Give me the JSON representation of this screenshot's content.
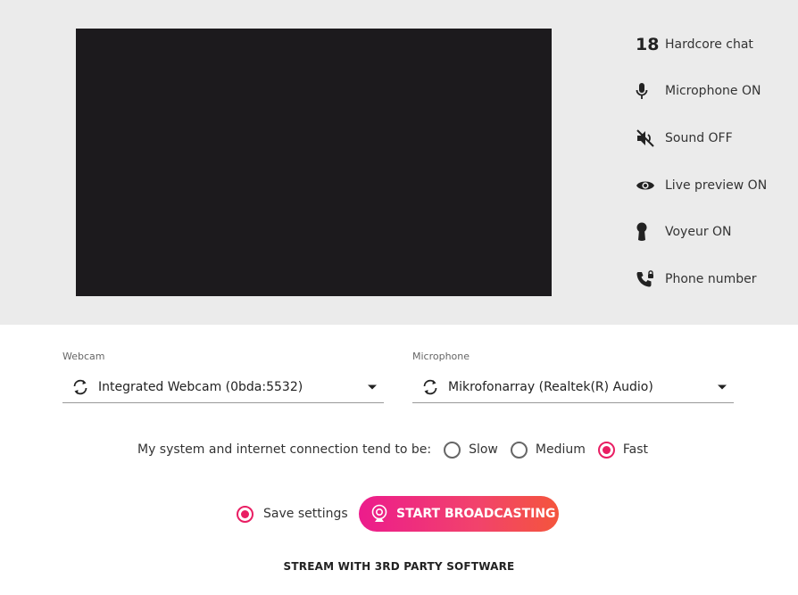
{
  "side_menu": {
    "items": [
      {
        "number": "18",
        "label": "Hardcore chat",
        "icon": "eighteen-badge"
      },
      {
        "label": "Microphone ON",
        "icon": "microphone-icon"
      },
      {
        "label": "Sound OFF",
        "icon": "sound-off-icon"
      },
      {
        "label": "Live preview ON",
        "icon": "eye-icon"
      },
      {
        "label": "Voyeur ON",
        "icon": "keyhole-icon"
      },
      {
        "label": "Phone number",
        "icon": "phone-icon"
      }
    ]
  },
  "webcam": {
    "label": "Webcam",
    "value": "Integrated Webcam (0bda:5532)"
  },
  "microphone": {
    "label": "Microphone",
    "value": "Mikrofonarray (Realtek(R) Audio)"
  },
  "connection": {
    "label": "My system and internet connection tend to be:",
    "options": [
      "Slow",
      "Medium",
      "Fast"
    ],
    "selected": "Fast"
  },
  "save_settings": {
    "label": "Save settings",
    "checked": true
  },
  "broadcast_button": {
    "label": "START BROADCASTING"
  },
  "third_party_link": {
    "label": "STREAM WITH 3RD PARTY SOFTWARE"
  },
  "colors": {
    "accent": "#e91e63",
    "panel_bg": "#ebebeb",
    "preview_bg": "#1c1a1d"
  }
}
